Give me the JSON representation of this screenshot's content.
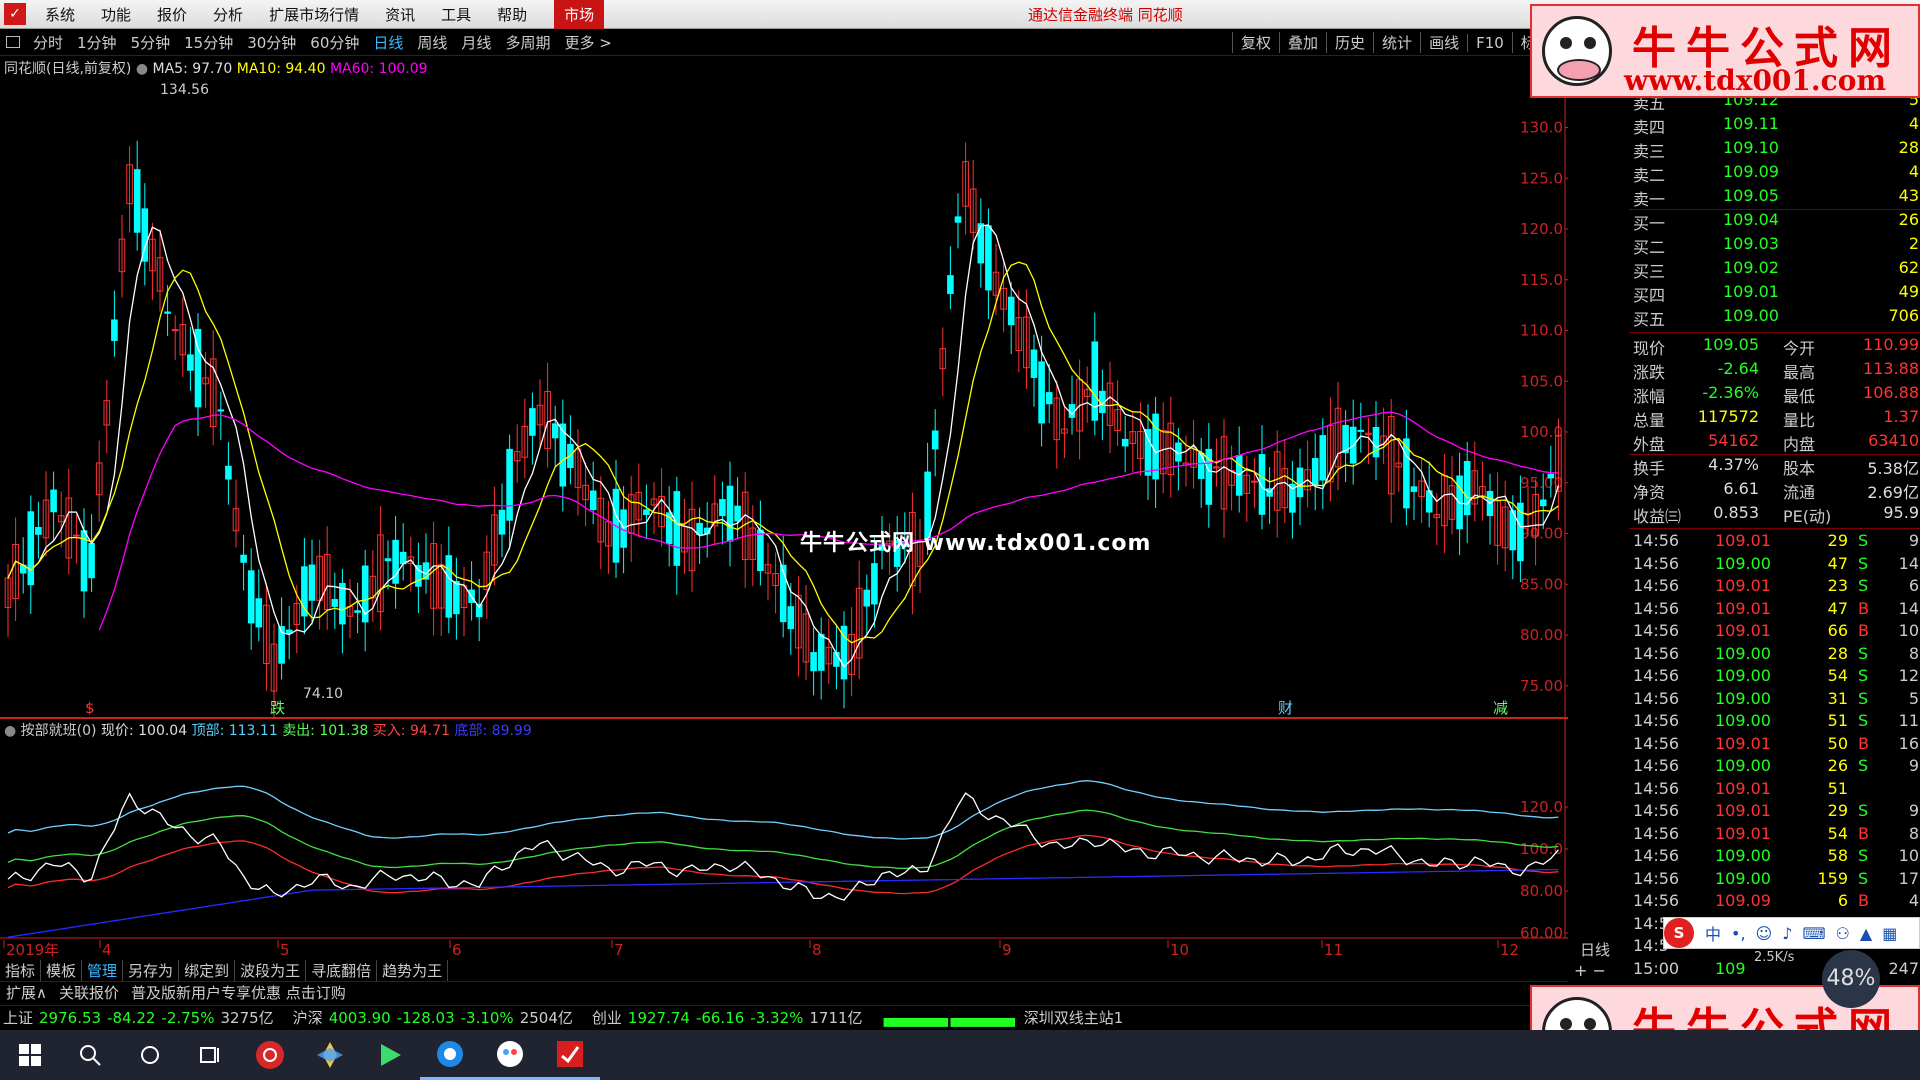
{
  "menubar": {
    "items": [
      "系统",
      "功能",
      "报价",
      "分析",
      "扩展市场行情",
      "资讯",
      "工具",
      "帮助"
    ],
    "market": "市场",
    "center": "通达信金融终端  同花顺"
  },
  "toolbar": {
    "periods": [
      "分时",
      "1分钟",
      "5分钟",
      "15分钟",
      "30分钟",
      "60分钟",
      "日线",
      "周线",
      "月线",
      "多周期",
      "更多 >"
    ],
    "active": "日线",
    "right": [
      "复权",
      "叠加",
      "历史",
      "统计",
      "画线",
      "F10",
      "标记"
    ]
  },
  "main": {
    "name": "同花顺(日线,前复权)",
    "ma5": "MA5: 97.70",
    "ma10": "MA10: 94.40",
    "ma60": "MA60: 100.09",
    "high_label": "134.56",
    "low_label": "74.10",
    "colors": {
      "up": "#ff3232",
      "down": "#00ffff",
      "ma5": "#ffffff",
      "ma10": "#ffff00",
      "ma60": "#ff00ff",
      "grid": "#7a0000",
      "axis": "#cc2222"
    },
    "yticks": [
      "130.0",
      "125.0",
      "120.0",
      "115.0",
      "110.0",
      "105.0",
      "100.0",
      "95.00",
      "90.00",
      "85.00",
      "80.00",
      "75.00"
    ],
    "markers": [
      "$",
      "跌",
      "财",
      "减"
    ]
  },
  "indicator": {
    "name": "按部就班(0)",
    "now": "现价: 100.04",
    "top": "顶部: 113.11",
    "sell": "卖出: 101.38",
    "buy": "买入: 94.71",
    "bottom": "底部: 89.99",
    "yticks": [
      "120.0",
      "100.0",
      "80.00",
      "60.00"
    ]
  },
  "xaxis": {
    "labels": [
      "2019年",
      "4",
      "5",
      "6",
      "7",
      "8",
      "9",
      "10",
      "11",
      "12"
    ],
    "period": "日线"
  },
  "bottomtabs": [
    "指标",
    "模板",
    "管理",
    "另存为",
    "绑定到",
    "波段为王",
    "寻底翻倍",
    "趋势为王"
  ],
  "extbar": [
    "扩展∧",
    "关联报价",
    "普及版新用户专享优惠 点击订购"
  ],
  "zoom": "+ −",
  "status": {
    "sh_label": "上证",
    "sh_val": "2976.53",
    "sh_chg": "-84.22",
    "sh_pct": "-2.75%",
    "sh_amt": "3275亿",
    "hs_label": "沪深",
    "hs_val": "4003.90",
    "hs_chg": "-128.03",
    "hs_pct": "-3.10%",
    "hs_amt": "2504亿",
    "cy_label": "创业",
    "cy_val": "1927.74",
    "cy_chg": "-66.16",
    "cy_pct": "-3.32%",
    "cy_amt": "1711亿",
    "server": "深圳双线主站1"
  },
  "orderbook": {
    "sell": [
      [
        "卖五",
        "109.12",
        "5"
      ],
      [
        "卖四",
        "109.11",
        "4"
      ],
      [
        "卖三",
        "109.10",
        "28"
      ],
      [
        "卖二",
        "109.09",
        "4"
      ],
      [
        "卖一",
        "109.05",
        "43"
      ]
    ],
    "buy": [
      [
        "买一",
        "109.04",
        "26"
      ],
      [
        "买二",
        "109.03",
        "2"
      ],
      [
        "买三",
        "109.02",
        "62"
      ],
      [
        "买四",
        "109.01",
        "49"
      ],
      [
        "买五",
        "109.00",
        "706"
      ]
    ]
  },
  "quote": [
    [
      "现价",
      "109.05",
      "今开",
      "110.99"
    ],
    [
      "涨跌",
      "-2.64",
      "最高",
      "113.88"
    ],
    [
      "涨幅",
      "-2.36%",
      "最低",
      "106.88"
    ],
    [
      "总量",
      "117572",
      "量比",
      "1.37"
    ],
    [
      "外盘",
      "54162",
      "内盘",
      "63410"
    ]
  ],
  "quote2": [
    [
      "换手",
      "4.37%",
      "股本",
      "5.38亿"
    ],
    [
      "净资",
      "6.61",
      "流通",
      "2.69亿"
    ],
    [
      "收益㈢",
      "0.853",
      "PE(动)",
      "95.9"
    ]
  ],
  "ticks": [
    [
      "14:56",
      "109.01",
      "29",
      "S",
      "9"
    ],
    [
      "14:56",
      "109.00",
      "47",
      "S",
      "14"
    ],
    [
      "14:56",
      "109.01",
      "23",
      "S",
      "6"
    ],
    [
      "14:56",
      "109.01",
      "47",
      "B",
      "14"
    ],
    [
      "14:56",
      "109.01",
      "66",
      "B",
      "10"
    ],
    [
      "14:56",
      "109.00",
      "28",
      "S",
      "8"
    ],
    [
      "14:56",
      "109.00",
      "54",
      "S",
      "12"
    ],
    [
      "14:56",
      "109.00",
      "31",
      "S",
      "5"
    ],
    [
      "14:56",
      "109.00",
      "51",
      "S",
      "11"
    ],
    [
      "14:56",
      "109.01",
      "50",
      "B",
      "16"
    ],
    [
      "14:56",
      "109.00",
      "26",
      "S",
      "9"
    ],
    [
      "14:56",
      "109.01",
      "51",
      "",
      ""
    ],
    [
      "14:56",
      "109.01",
      "29",
      "S",
      "9"
    ],
    [
      "14:56",
      "109.01",
      "54",
      "B",
      "8"
    ],
    [
      "14:56",
      "109.00",
      "58",
      "S",
      "10"
    ],
    [
      "14:56",
      "109.00",
      "159",
      "S",
      "17"
    ],
    [
      "14:56",
      "109.09",
      "6",
      "B",
      "4"
    ],
    [
      "14:57",
      "",
      "",
      " ",
      ""
    ],
    [
      "14:5",
      "",
      "",
      " ",
      ""
    ],
    [
      "15:00",
      "109",
      "",
      "",
      "247"
    ]
  ],
  "ads": {
    "title": "牛牛公式网",
    "url": "www.tdx001.com"
  },
  "watermark": "牛牛公式网 www.tdx001.com",
  "ime": {
    "label": "中"
  },
  "speed": {
    "pct": "48%",
    "rate": "2.5K/s"
  }
}
